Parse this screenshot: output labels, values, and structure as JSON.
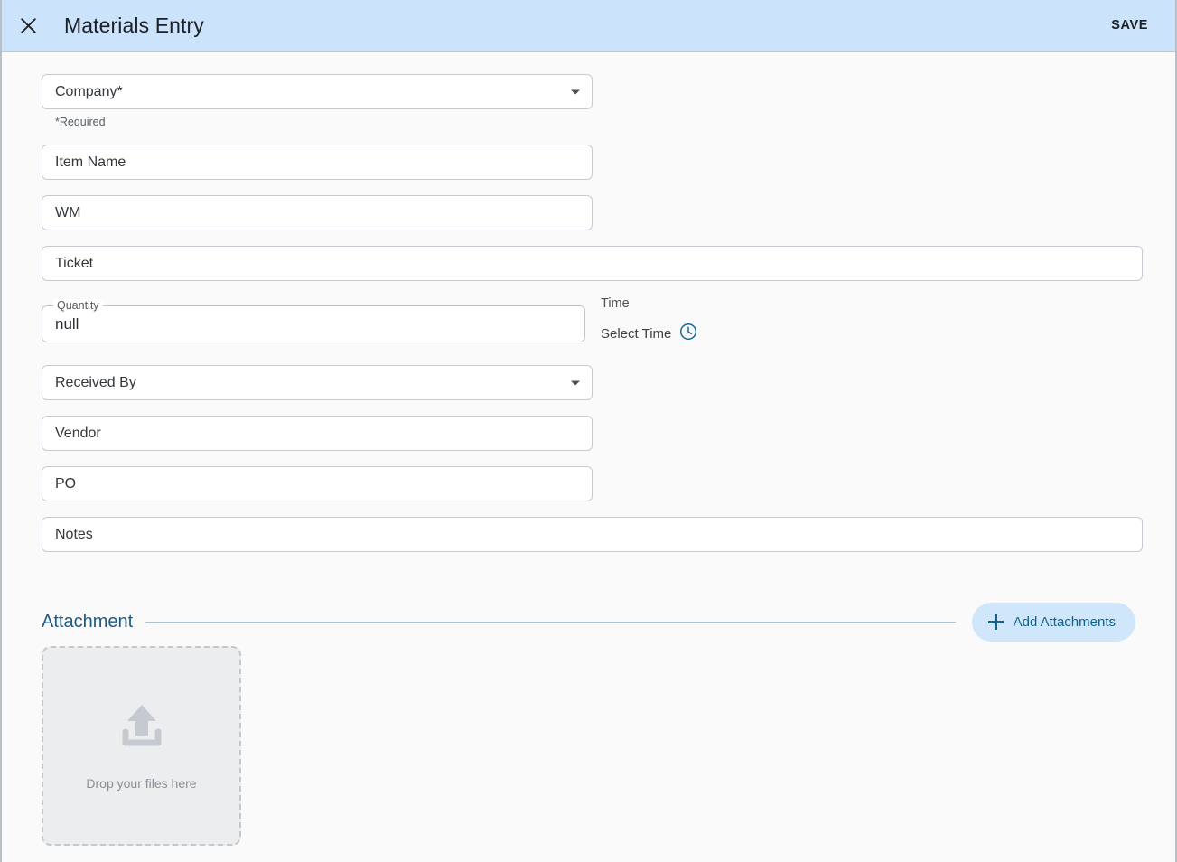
{
  "header": {
    "close_icon": "close-icon",
    "title": "Materials Entry",
    "save_label": "SAVE"
  },
  "form": {
    "company": {
      "label": "Company*",
      "value": "",
      "helper": "*Required",
      "caret_icon": "chevron-down-icon"
    },
    "item_name": {
      "label": "Item Name",
      "value": ""
    },
    "wm": {
      "label": "WM",
      "value": ""
    },
    "ticket": {
      "label": "Ticket",
      "value": ""
    },
    "quantity": {
      "legend": "Quantity",
      "value": "null"
    },
    "time": {
      "label": "Time",
      "select_label": "Select Time",
      "clock_icon": "clock-icon"
    },
    "received_by": {
      "label": "Received By",
      "value": "",
      "caret_icon": "chevron-down-icon"
    },
    "vendor": {
      "label": "Vendor",
      "value": ""
    },
    "po": {
      "label": "PO",
      "value": ""
    },
    "notes": {
      "label": "Notes",
      "value": ""
    }
  },
  "attachment": {
    "section_title": "Attachment",
    "add_button_label": "Add Attachments",
    "add_button_icon": "plus-icon",
    "dropzone": {
      "upload_icon": "upload-icon",
      "text": "Drop your files here"
    }
  },
  "colors": {
    "header_background": "#cbe3fb",
    "page_background": "#fafafb",
    "accent_blue": "#10638f",
    "section_title": "#1b5b84",
    "chip_background": "#cfe6fb",
    "field_border": "#c6cbd1"
  }
}
